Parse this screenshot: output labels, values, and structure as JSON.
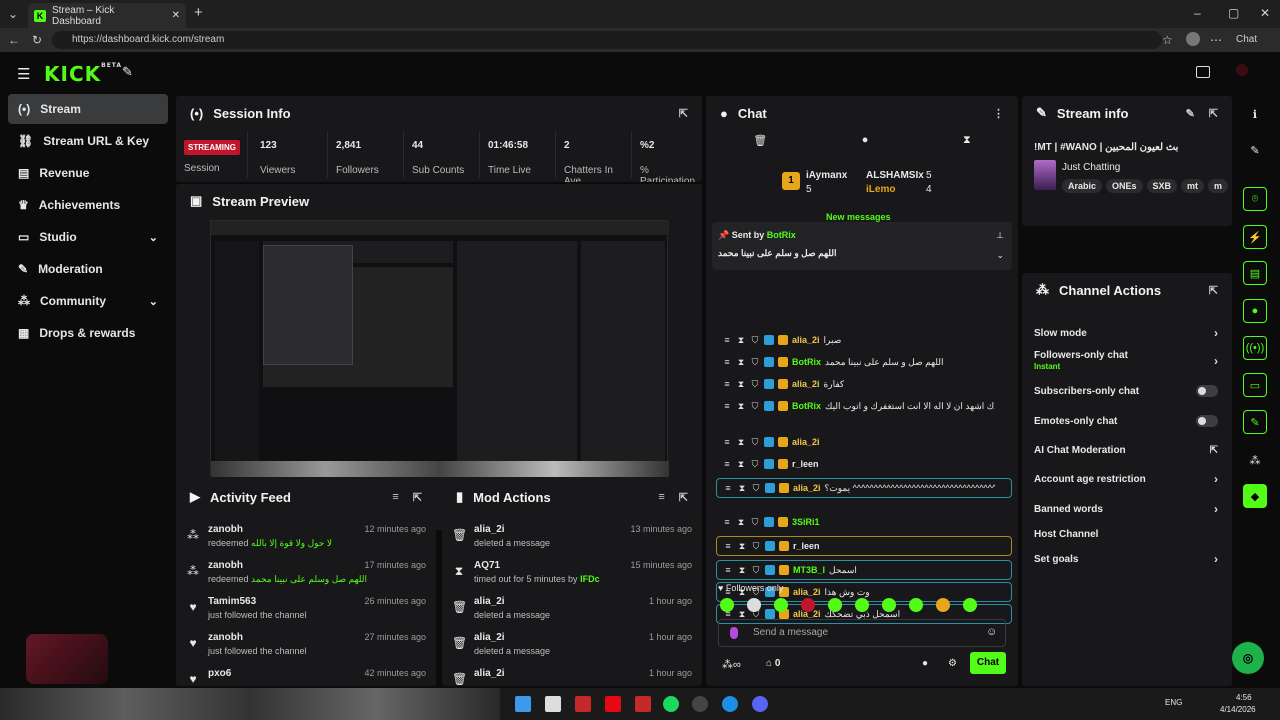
{
  "browser": {
    "tab_title": "Stream – Kick Dashboard",
    "url": "https://dashboard.kick.com/stream",
    "profile_label": "Chat"
  },
  "brand": {
    "logo": "KICK",
    "beta": "BETA",
    "accent": "#53fc18"
  },
  "sidebar": {
    "items": [
      {
        "label": "Stream",
        "icon": "broadcast-icon"
      },
      {
        "label": "Stream URL & Key",
        "icon": "link-icon"
      },
      {
        "label": "Revenue",
        "icon": "revenue-icon"
      },
      {
        "label": "Achievements",
        "icon": "trophy-icon"
      },
      {
        "label": "Studio",
        "icon": "studio-icon"
      },
      {
        "label": "Moderation",
        "icon": "wrench-icon"
      },
      {
        "label": "Community",
        "icon": "community-icon"
      },
      {
        "label": "Drops & rewards",
        "icon": "drops-icon"
      }
    ]
  },
  "session": {
    "title": "Session Info",
    "status": "STREAMING",
    "status_label": "Session",
    "stats": [
      {
        "value": "123",
        "label": "Viewers"
      },
      {
        "value": "2,841",
        "label": "Followers"
      },
      {
        "value": "44",
        "label": "Sub Counts"
      },
      {
        "value": "01:46:58",
        "label": "Time Live"
      },
      {
        "value": "2",
        "label": "Chatters In Ave"
      },
      {
        "value": "%2",
        "label": "% Participation"
      }
    ]
  },
  "preview": {
    "title": "Stream Preview"
  },
  "activity": {
    "title": "Activity Feed",
    "rows": [
      {
        "name": "zanobh",
        "action": "redeemed",
        "detail": "لا حول ولا قوة إلا بالله",
        "time": "12 minutes ago",
        "icon": "community-icon"
      },
      {
        "name": "zanobh",
        "action": "redeemed",
        "detail": "اللهم صل وسلم على نبينا محمد",
        "time": "17 minutes ago",
        "icon": "community-icon"
      },
      {
        "name": "Tamim563",
        "action": "just followed the channel",
        "detail": "",
        "time": "26 minutes ago",
        "icon": "heart-icon"
      },
      {
        "name": "zanobh",
        "action": "just followed the channel",
        "detail": "",
        "time": "27 minutes ago",
        "icon": "heart-icon"
      },
      {
        "name": "pxo6",
        "action": "",
        "detail": "",
        "time": "42 minutes ago",
        "icon": "heart-icon"
      }
    ]
  },
  "mod_actions": {
    "title": "Mod Actions",
    "rows": [
      {
        "name": "alia_2i",
        "action": "deleted a message",
        "by": "",
        "time": "13 minutes ago",
        "icon": "trash-icon"
      },
      {
        "name": "AQ71",
        "action": "timed out for 5 minutes by",
        "by": "IFDc",
        "time": "15 minutes ago",
        "icon": "hourglass-icon"
      },
      {
        "name": "alia_2i",
        "action": "deleted a message",
        "by": "",
        "time": "1 hour ago",
        "icon": "trash-icon"
      },
      {
        "name": "alia_2i",
        "action": "deleted a message",
        "by": "",
        "time": "1 hour ago",
        "icon": "trash-icon"
      },
      {
        "name": "alia_2i",
        "action": "",
        "by": "",
        "time": "1 hour ago",
        "icon": "trash-icon"
      }
    ]
  },
  "chat": {
    "title": "Chat",
    "top_gifters": [
      {
        "rank": "1",
        "name": "iAymanx",
        "count": "5"
      },
      {
        "rank": "",
        "name": "ALSHAMSIx",
        "count": "5"
      },
      {
        "rank": "",
        "name": "iLemo",
        "count": "4"
      }
    ],
    "new_messages": "New messages",
    "pinned": {
      "sent_by_label": "Sent by",
      "sender": "BotRix",
      "text": "اللهم صل و سلم على نبينا محمد"
    },
    "messages": [
      {
        "user": "alia_2i",
        "text": "صبرا",
        "color": "#f2c94c",
        "style": ""
      },
      {
        "user": "BotRix",
        "text": "اللهم صل و سلم على نبينا محمد",
        "color": "#53fc18",
        "style": ""
      },
      {
        "user": "alia_2i",
        "text": "كفارة",
        "color": "#f2c94c",
        "style": ""
      },
      {
        "user": "BotRix",
        "text": "سبحانك اللهم و بحمدك اشهد ان لا اله الا انت استغفرك و اتوب اليك",
        "color": "#53fc18",
        "style": ""
      },
      {
        "user": "alia_2i",
        "text": "",
        "color": "#f2c94c",
        "style": ""
      },
      {
        "user": "r_leen",
        "text": "",
        "color": "#e8e8e8",
        "style": ""
      },
      {
        "user": "alia_2i",
        "text": "يموت؟ ^^^^^^^^^^^^^^^^^^^^^^^^^^^^^^^^^^^^^^",
        "color": "#f2c94c",
        "style": "box"
      },
      {
        "user": "3SiRi1",
        "text": "",
        "color": "#53fc18",
        "style": ""
      },
      {
        "user": "r_leen",
        "text": "",
        "color": "#e8e8e8",
        "style": "gold"
      },
      {
        "user": "MT3B_l",
        "text": "اسمحل",
        "color": "#53fc18",
        "style": "box"
      },
      {
        "user": "alia_2i",
        "text": "وت وش هذا",
        "color": "#f2c94c",
        "style": "box"
      },
      {
        "user": "alia_2i",
        "text": "اسمحل ذبي تضحكك",
        "color": "#f2c94c",
        "style": "box"
      }
    ],
    "mode_label": "Followers only",
    "input_placeholder": "Send a message",
    "points": "0",
    "send_label": "Chat"
  },
  "stream_info": {
    "title": "Stream info",
    "stream_title": "!MT | #WANO | بث لعيون المحبين",
    "category": "Just Chatting",
    "tags": [
      "Arabic",
      "ONEs",
      "SXB",
      "mt",
      "m"
    ]
  },
  "channel_actions": {
    "title": "Channel Actions",
    "items": [
      {
        "label": "Slow mode",
        "sub": "",
        "kind": "arrow"
      },
      {
        "label": "Followers-only chat",
        "sub": "Instant",
        "kind": "arrow"
      },
      {
        "label": "Subscribers-only chat",
        "sub": "",
        "kind": "toggle"
      },
      {
        "label": "Emotes-only chat",
        "sub": "",
        "kind": "toggle"
      },
      {
        "label": "AI Chat Moderation",
        "sub": "",
        "kind": "external"
      },
      {
        "label": "Account age restriction",
        "sub": "",
        "kind": "arrow"
      },
      {
        "label": "Banned words",
        "sub": "",
        "kind": "arrow"
      },
      {
        "label": "Host Channel",
        "sub": "",
        "kind": "none"
      },
      {
        "label": "Set goals",
        "sub": "",
        "kind": "arrow"
      }
    ]
  },
  "taskbar": {
    "lang": "ENG",
    "time": "4:56",
    "date": "4/14/2026"
  }
}
